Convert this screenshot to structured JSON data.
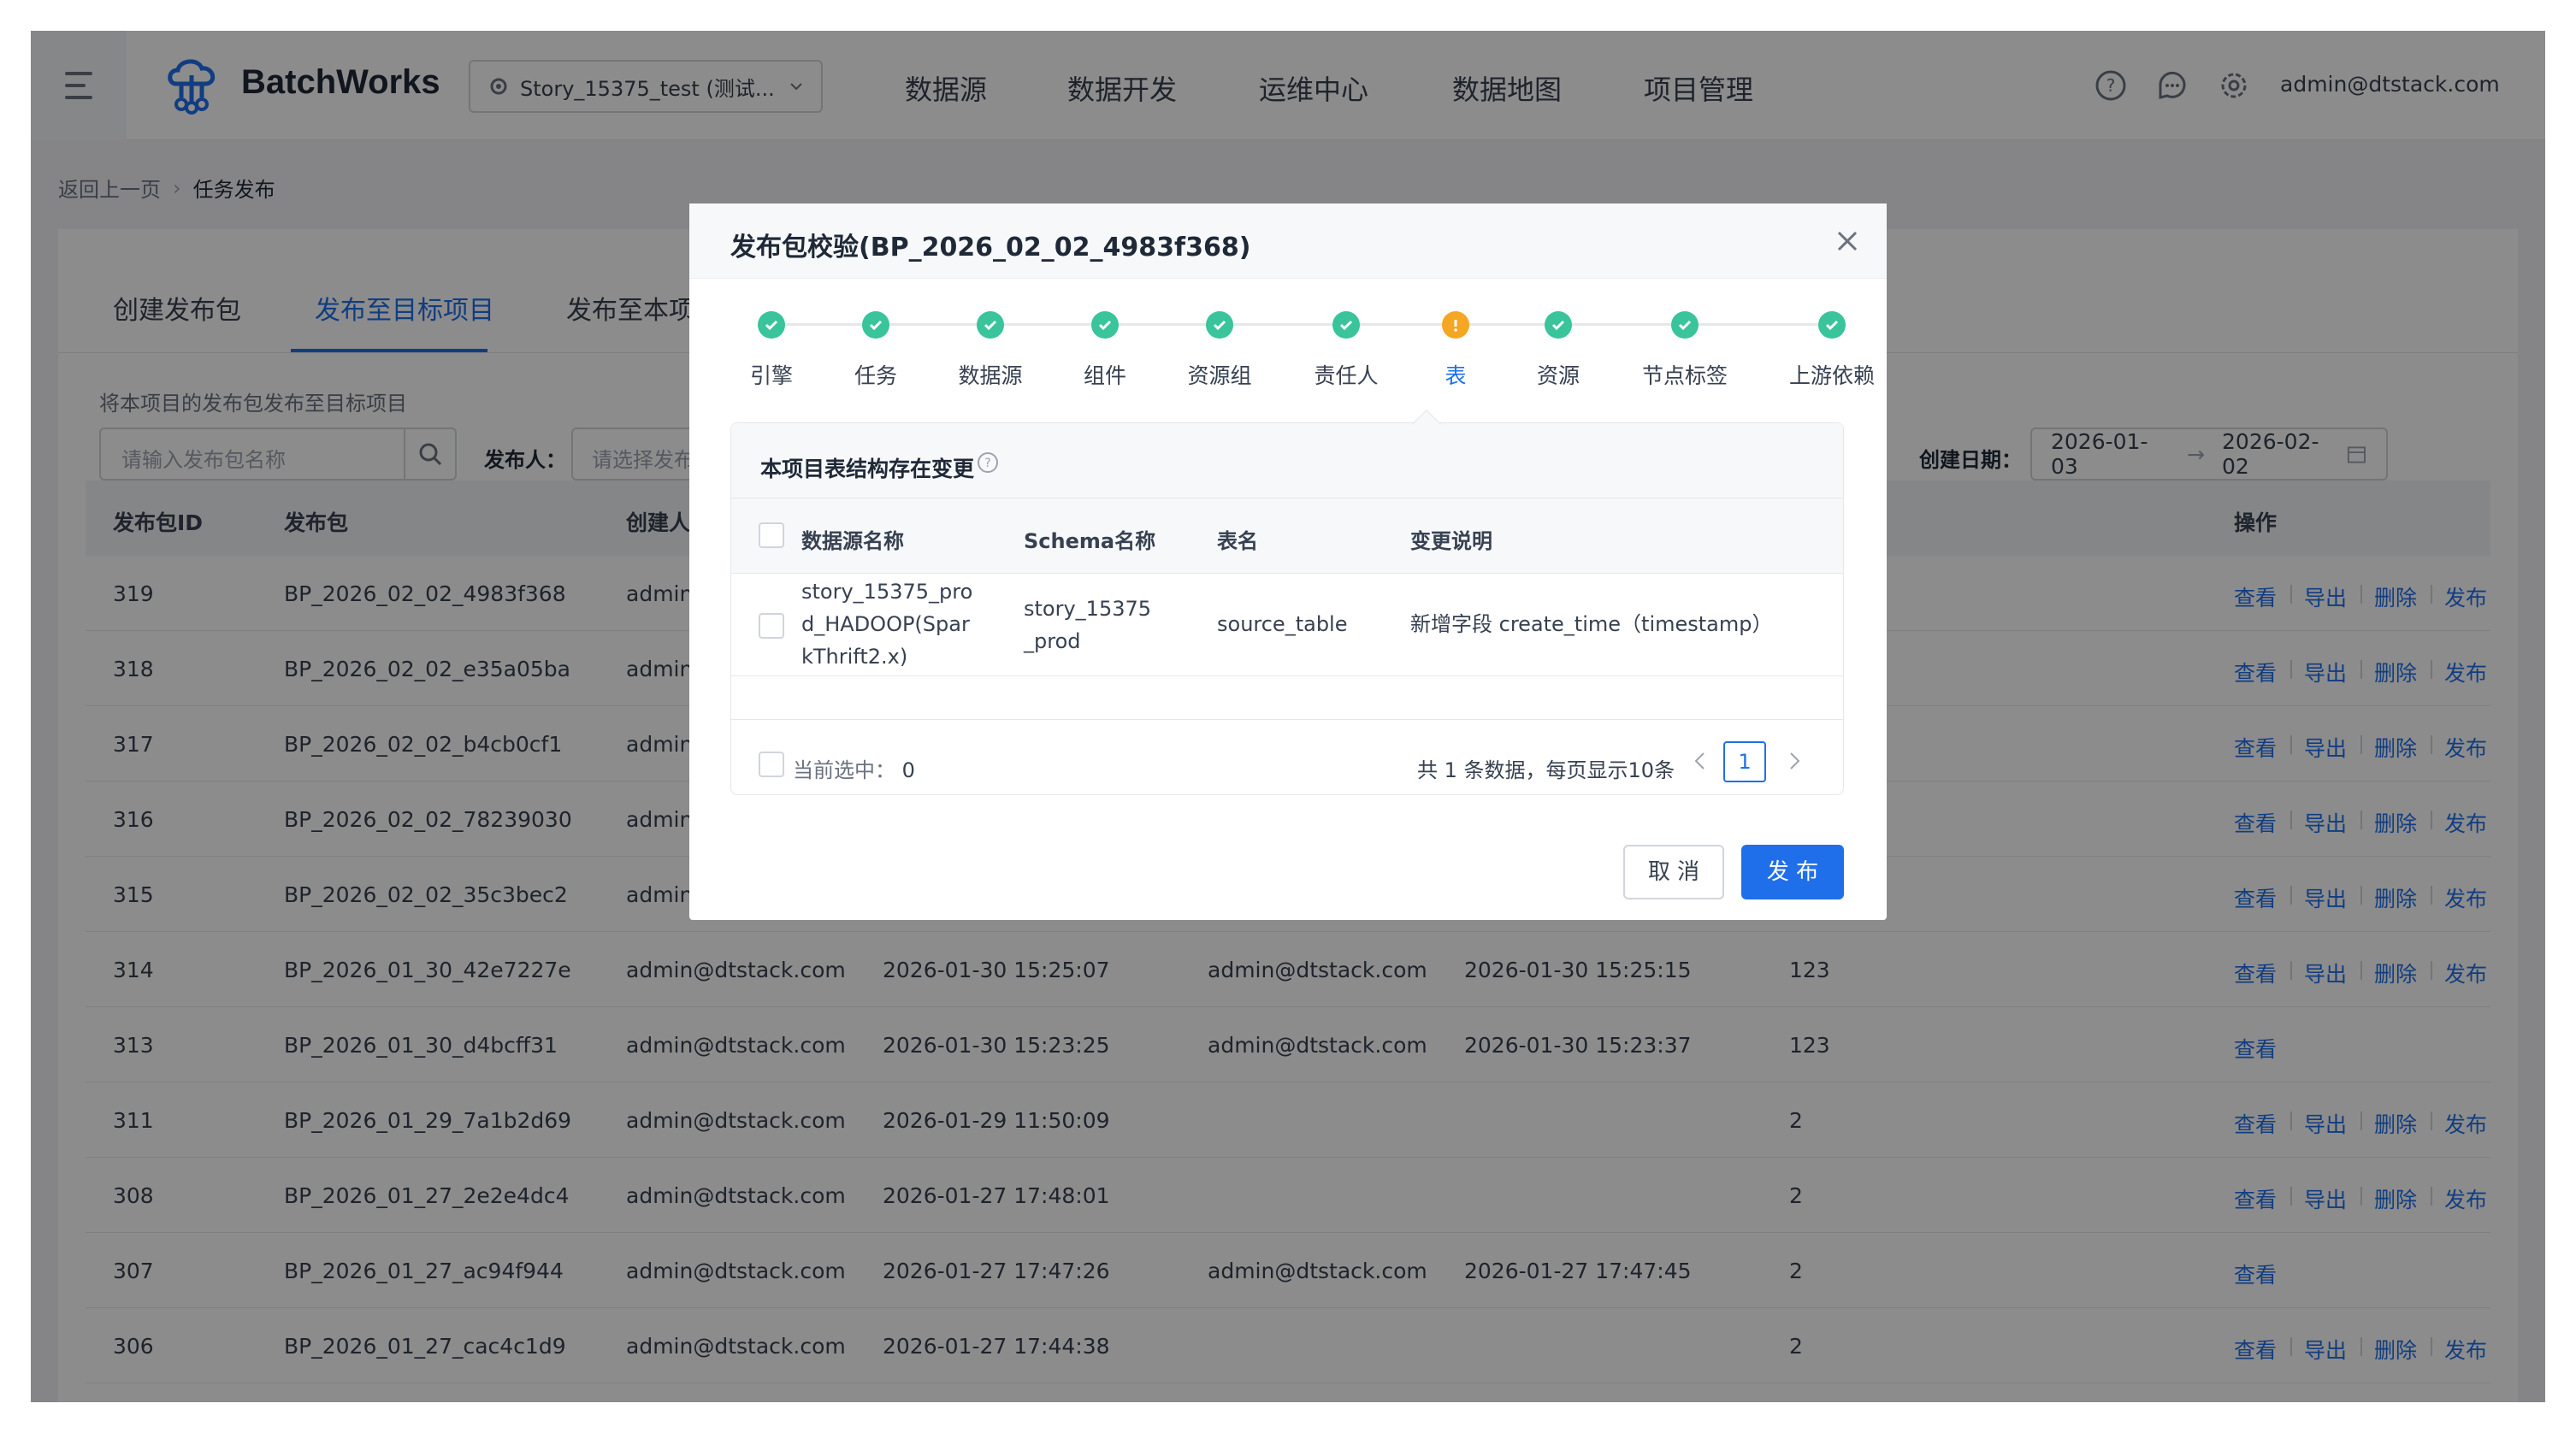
{
  "app": {
    "title": "BatchWorks",
    "project": "Story_15375_test (测试...",
    "nav": [
      "数据源",
      "数据开发",
      "运维中心",
      "数据地图",
      "项目管理"
    ],
    "user": "admin@dtstack.com"
  },
  "breadcrumb": {
    "back": "返回上一页",
    "current": "任务发布"
  },
  "tabs": [
    "创建发布包",
    "发布至目标项目",
    "发布至本项目"
  ],
  "active_tab_index": 1,
  "page": {
    "description": "将本项目的发布包发布至目标项目",
    "search_placeholder": "请输入发布包名称",
    "publisher_label": "发布人：",
    "publisher_placeholder": "请选择发布人",
    "date_label": "创建日期：",
    "date_start": "2026-01-03",
    "date_end": "2026-02-02"
  },
  "table": {
    "headers": {
      "id": "发布包ID",
      "package": "发布包",
      "creator": "创建人",
      "actions": "操作"
    },
    "rows": [
      {
        "id": "319",
        "package": "BP_2026_02_02_4983f368",
        "creator": "admin@dtstack.com",
        "created": "",
        "publisher": "",
        "published": "",
        "count": "",
        "actions": [
          "查看",
          "导出",
          "删除",
          "发布"
        ]
      },
      {
        "id": "318",
        "package": "BP_2026_02_02_e35a05ba",
        "creator": "admin@dtstack.com",
        "created": "",
        "publisher": "",
        "published": "",
        "count": "",
        "actions": [
          "查看",
          "导出",
          "删除",
          "发布"
        ]
      },
      {
        "id": "317",
        "package": "BP_2026_02_02_b4cb0cf1",
        "creator": "admin@dtstack.com",
        "created": "",
        "publisher": "",
        "published": "",
        "count": "",
        "actions": [
          "查看",
          "导出",
          "删除",
          "发布"
        ]
      },
      {
        "id": "316",
        "package": "BP_2026_02_02_78239030",
        "creator": "admin@dtstack.com",
        "created": "",
        "publisher": "",
        "published": "",
        "count": "",
        "actions": [
          "查看",
          "导出",
          "删除",
          "发布"
        ]
      },
      {
        "id": "315",
        "package": "BP_2026_02_02_35c3bec2",
        "creator": "admin@dtstack.com",
        "created": "",
        "publisher": "",
        "published": "",
        "count": "",
        "actions": [
          "查看",
          "导出",
          "删除",
          "发布"
        ]
      },
      {
        "id": "314",
        "package": "BP_2026_01_30_42e7227e",
        "creator": "admin@dtstack.com",
        "created": "2026-01-30 15:25:07",
        "publisher": "admin@dtstack.com",
        "published": "2026-01-30 15:25:15",
        "count": "123",
        "actions": [
          "查看",
          "导出",
          "删除",
          "发布"
        ]
      },
      {
        "id": "313",
        "package": "BP_2026_01_30_d4bcff31",
        "creator": "admin@dtstack.com",
        "created": "2026-01-30 15:23:25",
        "publisher": "admin@dtstack.com",
        "published": "2026-01-30 15:23:37",
        "count": "123",
        "actions": [
          "查看"
        ]
      },
      {
        "id": "311",
        "package": "BP_2026_01_29_7a1b2d69",
        "creator": "admin@dtstack.com",
        "created": "2026-01-29 11:50:09",
        "publisher": "",
        "published": "",
        "count": "2",
        "actions": [
          "查看",
          "导出",
          "删除",
          "发布"
        ]
      },
      {
        "id": "308",
        "package": "BP_2026_01_27_2e2e4dc4",
        "creator": "admin@dtstack.com",
        "created": "2026-01-27 17:48:01",
        "publisher": "",
        "published": "",
        "count": "2",
        "actions": [
          "查看",
          "导出",
          "删除",
          "发布"
        ]
      },
      {
        "id": "307",
        "package": "BP_2026_01_27_ac94f944",
        "creator": "admin@dtstack.com",
        "created": "2026-01-27 17:47:26",
        "publisher": "admin@dtstack.com",
        "published": "2026-01-27 17:47:45",
        "count": "2",
        "actions": [
          "查看"
        ]
      },
      {
        "id": "306",
        "package": "BP_2026_01_27_cac4c1d9",
        "creator": "admin@dtstack.com",
        "created": "2026-01-27 17:44:38",
        "publisher": "",
        "published": "",
        "count": "2",
        "actions": [
          "查看",
          "导出",
          "删除",
          "发布"
        ]
      }
    ]
  },
  "modal": {
    "title": "发布包校验(BP_2026_02_02_4983f368)",
    "steps": [
      {
        "label": "引擎",
        "status": "done"
      },
      {
        "label": "任务",
        "status": "done"
      },
      {
        "label": "数据源",
        "status": "done"
      },
      {
        "label": "组件",
        "status": "done"
      },
      {
        "label": "资源组",
        "status": "done"
      },
      {
        "label": "责任人",
        "status": "done"
      },
      {
        "label": "表",
        "status": "warning"
      },
      {
        "label": "资源",
        "status": "done"
      },
      {
        "label": "节点标签",
        "status": "done"
      },
      {
        "label": "上游依赖",
        "status": "done"
      }
    ],
    "active_step_index": 6,
    "panel_title": "本项目表结构存在变更",
    "columns": {
      "datasource": "数据源名称",
      "schema": "Schema名称",
      "table": "表名",
      "change": "变更说明"
    },
    "rows": [
      {
        "datasource": [
          "story_15375_pro",
          "d_HADOOP(Spar",
          "kThrift2.x)"
        ],
        "schema": [
          "story_15375",
          "_prod"
        ],
        "table": "source_table",
        "change": "新增字段 create_time（timestamp）"
      }
    ],
    "selected_label": "当前选中：",
    "selected_count": "0",
    "pager_text": "共 1 条数据，每页显示10条",
    "current_page": "1",
    "cancel": "取 消",
    "publish": "发 布"
  },
  "colors": {
    "primary": "#1f6feb",
    "success": "#39c49b",
    "warning": "#f5a623"
  }
}
